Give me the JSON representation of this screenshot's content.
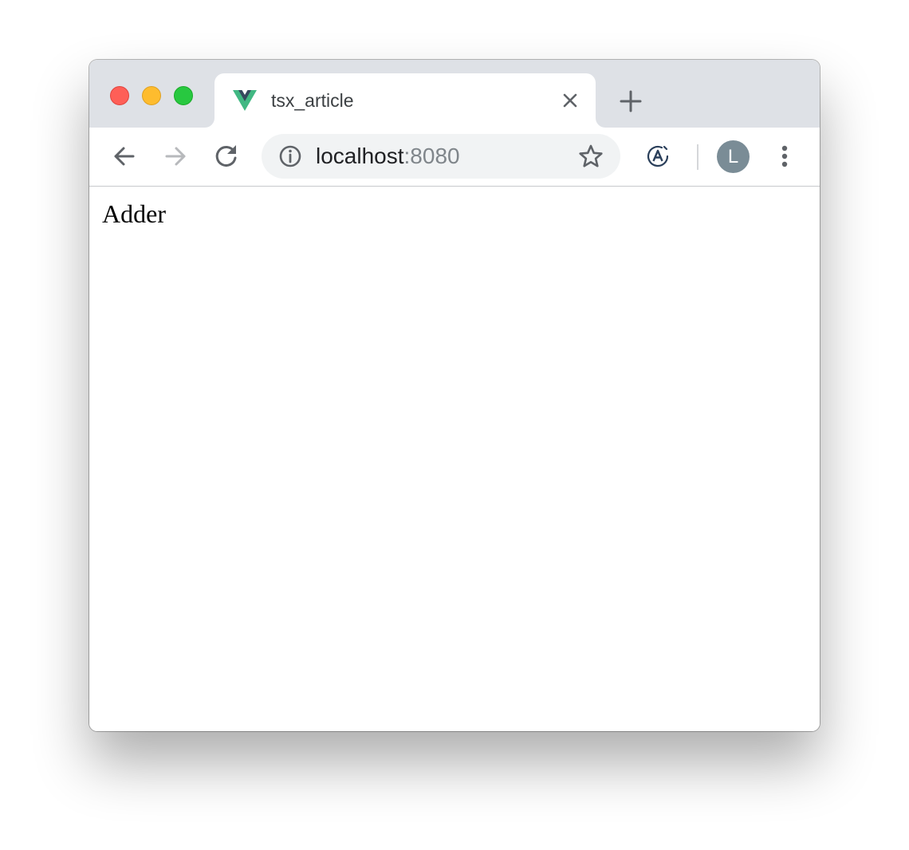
{
  "window": {
    "controls": [
      "close",
      "minimize",
      "maximize"
    ]
  },
  "tab": {
    "title": "tsx_article",
    "favicon": "vue-logo-icon"
  },
  "toolbar": {
    "back_icon": "arrow-left-icon",
    "forward_icon": "arrow-right-icon",
    "reload_icon": "reload-icon",
    "url_host": "localhost",
    "url_port": ":8080",
    "extension_icon": "extension-a-icon",
    "avatar_letter": "L"
  },
  "page": {
    "text": "Adder"
  },
  "colors": {
    "tabstrip": "#dee1e6",
    "omnibox": "#f1f3f4",
    "avatar": "#7a8c96",
    "vue_green": "#41b883",
    "vue_dark": "#35495e"
  }
}
